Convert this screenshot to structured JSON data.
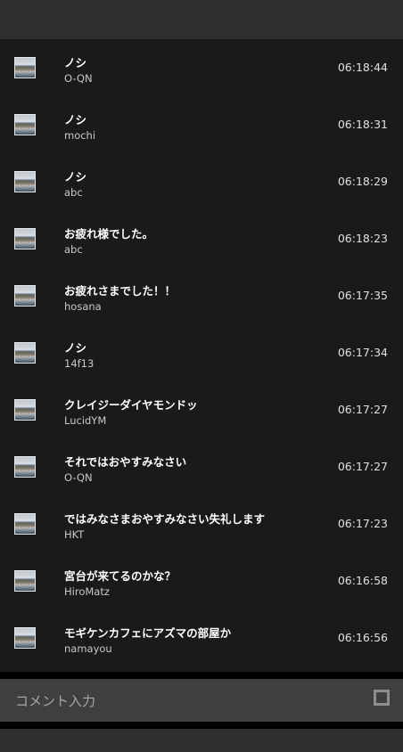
{
  "comments": [
    {
      "message": "ノシ",
      "user": "O-QN",
      "time": "06:18:44"
    },
    {
      "message": "ノシ",
      "user": "mochi",
      "time": "06:18:31"
    },
    {
      "message": "ノシ",
      "user": "abc",
      "time": "06:18:29"
    },
    {
      "message": "お疲れ様でした。",
      "user": "abc",
      "time": "06:18:23"
    },
    {
      "message": "お疲れさまでした！！",
      "user": "hosana",
      "time": "06:17:35"
    },
    {
      "message": "ノシ",
      "user": "14f13",
      "time": "06:17:34"
    },
    {
      "message": "クレイジーダイヤモンドッ",
      "user": "LucidYM",
      "time": "06:17:27"
    },
    {
      "message": "それではおやすみなさい",
      "user": "O-QN",
      "time": "06:17:27"
    },
    {
      "message": "ではみなさまおやすみなさい失礼します",
      "user": "HKT",
      "time": "06:17:23"
    },
    {
      "message": "宮台が来てるのかな？",
      "user": "HiroMatz",
      "time": "06:16:58"
    },
    {
      "message": "モギケンカフェにアズマの部屋か",
      "user": "namayou",
      "time": "06:16:56"
    }
  ],
  "comment_input": {
    "placeholder": "コメント入力",
    "checkbox_checked": false
  },
  "icons": {
    "avatar": "user-avatar-thumbnail",
    "checkbox": "checkbox-icon"
  }
}
